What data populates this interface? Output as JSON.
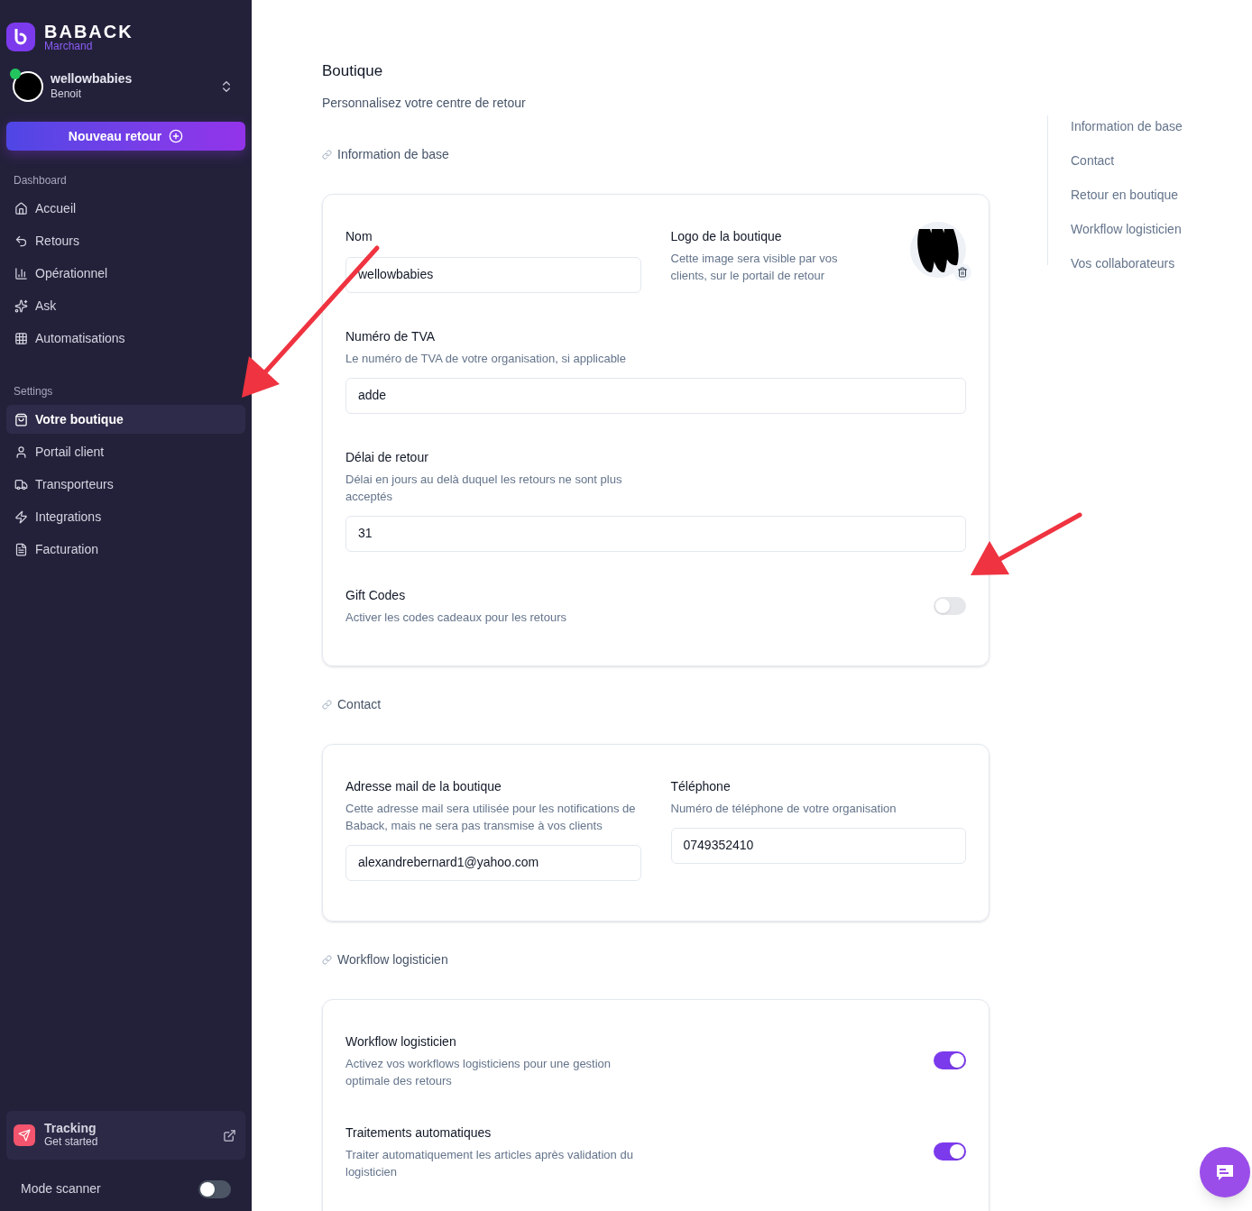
{
  "sidebar": {
    "brand": {
      "name": "BABACK",
      "subtitle": "Marchand"
    },
    "account": {
      "name": "wellowbabies",
      "user": "Benoit",
      "online": true
    },
    "new_button": "Nouveau retour",
    "sections": [
      {
        "title": "Dashboard",
        "items": [
          {
            "label": "Accueil",
            "selected": false
          },
          {
            "label": "Retours",
            "selected": false
          },
          {
            "label": "Opérationnel",
            "selected": false
          },
          {
            "label": "Ask",
            "selected": false
          },
          {
            "label": "Automatisations",
            "selected": false
          }
        ]
      },
      {
        "title": "Settings",
        "items": [
          {
            "label": "Votre boutique",
            "selected": true
          },
          {
            "label": "Portail client",
            "selected": false
          },
          {
            "label": "Transporteurs",
            "selected": false
          },
          {
            "label": "Integrations",
            "selected": false
          },
          {
            "label": "Facturation",
            "selected": false
          }
        ]
      }
    ],
    "tracking": {
      "title": "Tracking",
      "subtitle": "Get started"
    },
    "scanner": {
      "label": "Mode scanner",
      "on": false
    }
  },
  "page": {
    "title": "Boutique",
    "subtitle": "Personnalisez votre centre de retour"
  },
  "sections": [
    {
      "heading": "Information de base",
      "rows": [
        {
          "kind": "pair",
          "items": [
            {
              "kind": "field",
              "label": "Nom",
              "value": "wellowbabies"
            },
            {
              "kind": "logo",
              "label": "Logo de la boutique",
              "description": "Cette image sera visible par vos clients, sur le portail de retour"
            }
          ]
        },
        {
          "kind": "field",
          "label": "Numéro de TVA",
          "description": "Le numéro de TVA de votre organisation, si applicable",
          "value": "adde"
        },
        {
          "kind": "field",
          "label": "Délai de retour",
          "description": "Délai en jours au delà duquel les retours ne sont plus acceptés",
          "value": "31"
        },
        {
          "kind": "toggle",
          "label": "Gift Codes",
          "description": "Activer les codes cadeaux pour les retours",
          "on": false
        }
      ]
    },
    {
      "heading": "Contact",
      "rows": [
        {
          "kind": "pair",
          "items": [
            {
              "kind": "field",
              "label": "Adresse mail de la boutique",
              "description": "Cette adresse mail sera utilisée pour les notifications de Baback, mais ne sera pas transmise à vos clients",
              "value": "alexandrebernard1@yahoo.com"
            },
            {
              "kind": "field",
              "label": "Téléphone",
              "description": "Numéro de téléphone de votre organisation",
              "value": "0749352410"
            }
          ]
        }
      ]
    },
    {
      "heading": "Workflow logisticien",
      "rows": [
        {
          "kind": "toggle",
          "label": "Workflow logisticien",
          "description": "Activez vos workflows logisticiens pour une gestion optimale des retours",
          "on": true
        },
        {
          "kind": "toggle",
          "label": "Traitements automatiques",
          "description": "Traiter automatiquement les articles après validation du logisticien",
          "on": true
        }
      ]
    }
  ],
  "toc": [
    {
      "label": "Information de base"
    },
    {
      "label": "Contact"
    },
    {
      "label": "Retour en boutique"
    },
    {
      "label": "Workflow logisticien"
    },
    {
      "label": "Vos collaborateurs"
    }
  ]
}
